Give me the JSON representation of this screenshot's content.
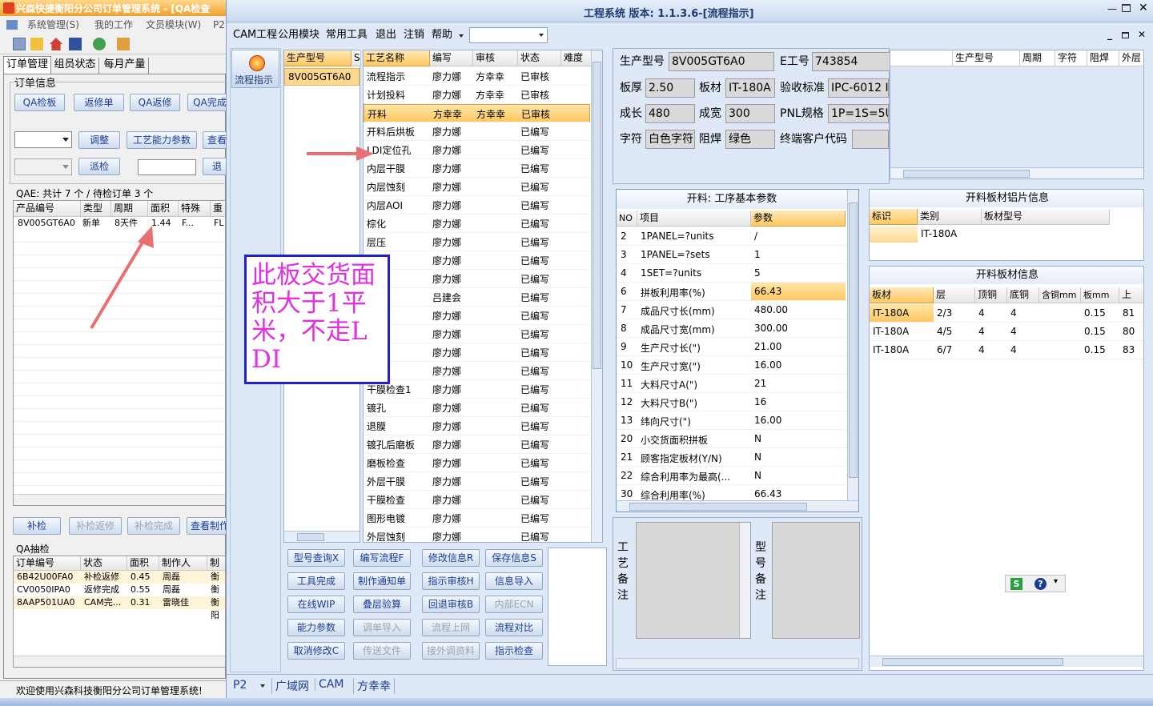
{
  "left_app": {
    "title": "兴森快捷衡阳分公司订单管理系统 - [QA检查",
    "menu": [
      "系统管理(S)",
      "我的工作",
      "文员模块(W)",
      "P2"
    ],
    "tabs": [
      "订单管理",
      "组员状态",
      "每月产量"
    ],
    "group1": "订单信息",
    "buttons_row1": [
      "QA检板",
      "返修单",
      "QA返修",
      "QA完成"
    ],
    "buttons_row2": [
      "调整",
      "工艺能力参数",
      "查看"
    ],
    "buttons_row3": [
      "派检",
      "退"
    ],
    "qae_text": "QAE: 共计 7 个 / 待检订单 3 个",
    "table1_headers": [
      "产品编号",
      "类型",
      "周期",
      "面积",
      "特殊",
      "重"
    ],
    "table1_rows": [
      [
        "8V005GT6A0",
        "新单",
        "8天件",
        "1.44",
        "F...",
        "FL"
      ]
    ],
    "buttons_bottom": [
      "补检",
      "补检返修",
      "补检完成",
      "查看制作"
    ],
    "group2": "QA抽检",
    "table2_headers": [
      "订单编号",
      "状态",
      "面积",
      "制作人",
      "制"
    ],
    "table2_rows": [
      [
        "6B42U00FA0",
        "补检返修",
        "0.45",
        "周磊",
        "衡阳"
      ],
      [
        "CV0050IPA0",
        "返修完成",
        "0.55",
        "周磊",
        "衡阳"
      ],
      [
        "8AAP501UA0",
        "CAM完...",
        "0.31",
        "雷晓佳",
        "衡阳"
      ]
    ],
    "status": "欢迎使用兴森科技衡阳分公司订单管理系统!"
  },
  "main": {
    "title": "工程系统 版本: 1.1.3.6-[流程指示]",
    "menu": [
      "CAM工程",
      "公用模块",
      "常用工具",
      "退出",
      "注销",
      "帮助"
    ],
    "flow_label": "流程指示",
    "product_list_header": "生产型号",
    "product_list_header2": "S",
    "product_list_value": "8V005GT6A0",
    "process_headers": [
      "工艺名称",
      "编写",
      "审核",
      "状态",
      "难度"
    ],
    "process_rows": [
      [
        "流程指示",
        "廖力娜",
        "方幸幸",
        "已审核"
      ],
      [
        "计划投料",
        "廖力娜",
        "方幸幸",
        "已审核"
      ],
      [
        "开料",
        "方幸幸",
        "方幸幸",
        "已审核"
      ],
      [
        "开料后烘板",
        "廖力娜",
        "",
        "已编写"
      ],
      [
        "LDI定位孔",
        "廖力娜",
        "",
        "已编写"
      ],
      [
        "内层干膜",
        "廖力娜",
        "",
        "已编写"
      ],
      [
        "内层蚀刻",
        "廖力娜",
        "",
        "已编写"
      ],
      [
        "内层AOI",
        "廖力娜",
        "",
        "已编写"
      ],
      [
        "棕化",
        "廖力娜",
        "",
        "已编写"
      ],
      [
        "层压",
        "廖力娜",
        "",
        "已编写"
      ],
      [
        "钻孔",
        "廖力娜",
        "",
        "已编写"
      ],
      [
        "",
        "廖力娜",
        "",
        "已编写"
      ],
      [
        "孔",
        "吕建会",
        "",
        "已编写"
      ],
      [
        "刻",
        "廖力娜",
        "",
        "已编写"
      ],
      [
        "",
        "廖力娜",
        "",
        "已编写"
      ],
      [
        "",
        "廖力娜",
        "",
        "已编写"
      ],
      [
        "干膜",
        "廖力娜",
        "",
        "已编写"
      ],
      [
        "干膜检查1",
        "廖力娜",
        "",
        "已编写"
      ],
      [
        "镀孔",
        "廖力娜",
        "",
        "已编写"
      ],
      [
        "退膜",
        "廖力娜",
        "",
        "已编写"
      ],
      [
        "镀孔后磨板",
        "廖力娜",
        "",
        "已编写"
      ],
      [
        "磨板检查",
        "廖力娜",
        "",
        "已编写"
      ],
      [
        "外层干膜",
        "廖力娜",
        "",
        "已编写"
      ],
      [
        "干膜检查",
        "廖力娜",
        "",
        "已编写"
      ],
      [
        "图形电镀",
        "廖力娜",
        "",
        "已编写"
      ],
      [
        "外层蚀刻",
        "廖力娜",
        "",
        "已编写"
      ]
    ],
    "annotation": "此板交货面积大于1平米，不走LDI",
    "buttons": [
      [
        "型号查询X",
        "编写流程F",
        "修改信息R",
        "保存信息S"
      ],
      [
        "工具完成",
        "制作通知单",
        "指示审核H",
        "信息导入"
      ],
      [
        "在线WIP",
        "叠层验算",
        "回退审核B",
        "内部ECN"
      ],
      [
        "能力参数",
        "调单导入",
        "流程上网",
        "流程对比"
      ],
      [
        "取消修改C",
        "传送文件",
        "接外调资料",
        "指示检查"
      ]
    ],
    "disabled_buttons": [
      "内部ECN",
      "调单导入",
      "流程上网",
      "传送文件",
      "接外调资料"
    ],
    "info": {
      "prod_label": "生产型号",
      "prod_value": "8V005GT6A0",
      "eng_label": "E工号",
      "eng_value": "743854",
      "thick_label": "板厚",
      "thick_value": "2.50",
      "mat_label": "板材",
      "mat_value": "IT-180A",
      "std_label": "验收标准",
      "std_value": "IPC-6012 I",
      "len_label": "成长",
      "len_value": "480",
      "wid_label": "成宽",
      "wid_value": "300",
      "pnl_label": "PNL规格",
      "pnl_value": "1P=1S=5U",
      "char_label": "字符",
      "char_value": "白色字符",
      "mask_label": "阻焊",
      "mask_value": "绿色",
      "cust_label": "终端客户代码",
      "cust_value": ""
    },
    "right_grid_headers": [
      "生产型号",
      "周期",
      "字符",
      "阻焊",
      "外层"
    ],
    "param_title": "开料: 工序基本参数",
    "param_headers": [
      "NO",
      "项目",
      "参数"
    ],
    "param_rows": [
      [
        "2",
        "1PANEL=?units",
        "/"
      ],
      [
        "3",
        "1PANEL=?sets",
        "1"
      ],
      [
        "4",
        "1SET=?units",
        "5"
      ],
      [
        "6",
        "拼板利用率(%)",
        "66.43"
      ],
      [
        "7",
        "成品尺寸长(mm)",
        "480.00"
      ],
      [
        "8",
        "成品尺寸宽(mm)",
        "300.00"
      ],
      [
        "9",
        "生产尺寸长(\")",
        "21.00"
      ],
      [
        "10",
        "生产尺寸宽(\")",
        "16.00"
      ],
      [
        "11",
        "大料尺寸A(\")",
        "21"
      ],
      [
        "12",
        "大料尺寸B(\")",
        "16"
      ],
      [
        "13",
        "纬向尺寸(\")",
        "16.00"
      ],
      [
        "20",
        "小交货面积拼板",
        "N"
      ],
      [
        "21",
        "顾客指定板材(Y/N)",
        "N"
      ],
      [
        "22",
        "综合利用率为最高(...",
        "N"
      ],
      [
        "30",
        "综合利用率(%)",
        "66.43"
      ]
    ],
    "photo_title": "开料板材铝片信息",
    "photo_headers": [
      "标识",
      "类别",
      "板材型号"
    ],
    "photo_row": [
      "",
      "IT-180A",
      ""
    ],
    "mat_title": "开料板材信息",
    "mat_headers": [
      "板材",
      "层",
      "顶铜",
      "底铜",
      "含铜mm",
      "板mm",
      "上"
    ],
    "mat_rows": [
      [
        "IT-180A",
        "2/3",
        "4",
        "4",
        "",
        "0.15",
        "81"
      ],
      [
        "IT-180A",
        "4/5",
        "4",
        "4",
        "",
        "0.15",
        "80"
      ],
      [
        "IT-180A",
        "6/7",
        "4",
        "4",
        "",
        "0.15",
        "83"
      ]
    ],
    "remark1": "工艺备注",
    "remark2": "型号备注",
    "statusbar": [
      "P2",
      "广域网",
      "CAM",
      "方幸幸"
    ]
  }
}
